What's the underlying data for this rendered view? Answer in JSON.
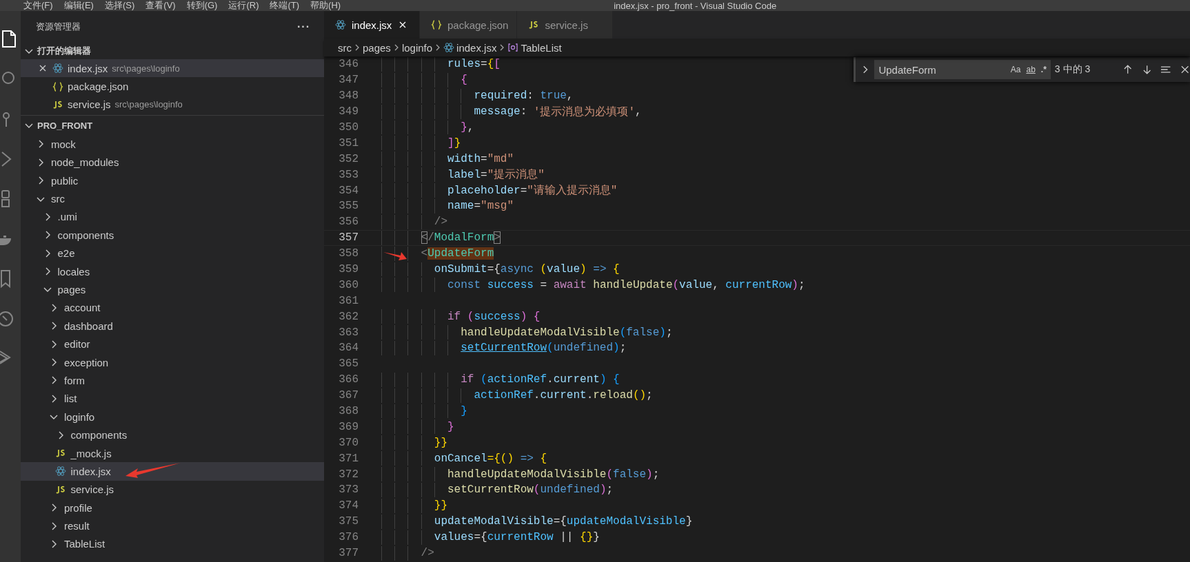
{
  "menu_bar": {
    "items": [
      "文件(F)",
      "编辑(E)",
      "选择(S)",
      "查看(V)",
      "转到(G)",
      "运行(R)",
      "终端(T)",
      "帮助(H)"
    ],
    "title": "index.jsx - pro_front - Visual Studio Code"
  },
  "explorer": {
    "title": "资源管理器",
    "more": "···",
    "open_editors": {
      "title": "打开的编辑器",
      "expanded": true,
      "items": [
        {
          "name": "index.jsx",
          "path": "src\\pages\\loginfo",
          "kind": "react",
          "selected": true
        },
        {
          "name": "package.json",
          "kind": "json",
          "selected": false
        },
        {
          "name": "service.js",
          "path": "src\\pages\\loginfo",
          "kind": "js",
          "selected": false
        }
      ]
    },
    "project": {
      "title": "PRO_FRONT",
      "expanded": true
    },
    "tree": [
      {
        "name": "mock",
        "kind": "folder",
        "expanded": false,
        "selected": false
      },
      {
        "name": "node_modules",
        "kind": "folder",
        "expanded": false,
        "selected": false
      },
      {
        "name": "public",
        "kind": "folder",
        "expanded": false,
        "selected": false
      },
      {
        "name": "src",
        "kind": "folder",
        "expanded": true,
        "selected": false,
        "children": [
          {
            "name": ".umi",
            "kind": "folder",
            "expanded": false,
            "selected": false
          },
          {
            "name": "components",
            "kind": "folder",
            "expanded": false,
            "selected": false
          },
          {
            "name": "e2e",
            "kind": "folder",
            "expanded": false,
            "selected": false
          },
          {
            "name": "locales",
            "kind": "folder",
            "expanded": false,
            "selected": false
          },
          {
            "name": "pages",
            "kind": "folder",
            "expanded": true,
            "selected": false,
            "children": [
              {
                "name": "account",
                "kind": "folder",
                "expanded": false,
                "selected": false
              },
              {
                "name": "dashboard",
                "kind": "folder",
                "expanded": false,
                "selected": false
              },
              {
                "name": "editor",
                "kind": "folder",
                "expanded": false,
                "selected": false
              },
              {
                "name": "exception",
                "kind": "folder",
                "expanded": false,
                "selected": false
              },
              {
                "name": "form",
                "kind": "folder",
                "expanded": false,
                "selected": false
              },
              {
                "name": "list",
                "kind": "folder",
                "expanded": false,
                "selected": false
              },
              {
                "name": "loginfo",
                "kind": "folder",
                "expanded": true,
                "selected": false,
                "children": [
                  {
                    "name": "components",
                    "kind": "folder",
                    "expanded": false,
                    "selected": false
                  },
                  {
                    "name": "_mock.js",
                    "kind": "js",
                    "selected": false
                  },
                  {
                    "name": "index.jsx",
                    "kind": "react",
                    "selected": true
                  },
                  {
                    "name": "service.js",
                    "kind": "js",
                    "selected": false
                  }
                ]
              },
              {
                "name": "profile",
                "kind": "folder",
                "expanded": false,
                "selected": false
              },
              {
                "name": "result",
                "kind": "folder",
                "expanded": false,
                "selected": false
              },
              {
                "name": "TableList",
                "kind": "folder",
                "expanded": false,
                "selected": false
              }
            ]
          }
        ]
      }
    ]
  },
  "tabs": [
    {
      "label": "index.jsx",
      "kind": "react",
      "selected": true
    },
    {
      "label": "package.json",
      "kind": "json",
      "selected": false
    },
    {
      "label": "service.js",
      "kind": "js",
      "selected": false
    }
  ],
  "breadcrumb": [
    "src",
    "pages",
    "loginfo",
    "index.jsx",
    "TableList"
  ],
  "find": {
    "value": "UpdateForm",
    "options": [
      "Aa",
      "ab",
      ".*"
    ],
    "count": "3 中的 3"
  },
  "code": [
    {
      "n": "346",
      "current": false,
      "tokens": [
        {
          "t": "          rules",
          "kind": "attr"
        },
        {
          "t": "=",
          "kind": "plain"
        },
        {
          "t": "{",
          "kind": "gold"
        },
        {
          "t": "[",
          "kind": "magenta"
        }
      ]
    },
    {
      "n": "347",
      "current": false,
      "tokens": [
        {
          "t": "            {",
          "kind": "magenta"
        }
      ]
    },
    {
      "n": "348",
      "current": false,
      "tokens": [
        {
          "t": "              required",
          "kind": "attr"
        },
        {
          "t": ": ",
          "kind": "plain"
        },
        {
          "t": "true",
          "kind": "keyword"
        },
        {
          "t": ",",
          "kind": "plain"
        }
      ]
    },
    {
      "n": "349",
      "current": false,
      "tokens": [
        {
          "t": "              message",
          "kind": "attr"
        },
        {
          "t": ": ",
          "kind": "plain"
        },
        {
          "t": "'提示消息为必填项'",
          "kind": "string"
        },
        {
          "t": ",",
          "kind": "plain"
        }
      ]
    },
    {
      "n": "350",
      "current": false,
      "tokens": [
        {
          "t": "            }",
          "kind": "magenta"
        },
        {
          "t": ",",
          "kind": "plain"
        }
      ]
    },
    {
      "n": "351",
      "current": false,
      "tokens": [
        {
          "t": "          ]",
          "kind": "magenta"
        },
        {
          "t": "}",
          "kind": "gold"
        }
      ]
    },
    {
      "n": "352",
      "current": false,
      "tokens": [
        {
          "t": "          width",
          "kind": "attr"
        },
        {
          "t": "=",
          "kind": "plain"
        },
        {
          "t": "\"md\"",
          "kind": "string"
        }
      ]
    },
    {
      "n": "353",
      "current": false,
      "tokens": [
        {
          "t": "          label",
          "kind": "attr"
        },
        {
          "t": "=",
          "kind": "plain"
        },
        {
          "t": "\"提示消息\"",
          "kind": "string"
        }
      ]
    },
    {
      "n": "354",
      "current": false,
      "tokens": [
        {
          "t": "          placeholder",
          "kind": "attr"
        },
        {
          "t": "=",
          "kind": "plain"
        },
        {
          "t": "\"请输入提示消息\"",
          "kind": "string"
        }
      ]
    },
    {
      "n": "355",
      "current": false,
      "tokens": [
        {
          "t": "          name",
          "kind": "attr"
        },
        {
          "t": "=",
          "kind": "plain"
        },
        {
          "t": "\"msg\"",
          "kind": "string"
        }
      ]
    },
    {
      "n": "356",
      "current": false,
      "tokens": [
        {
          "t": "        />",
          "kind": "punct"
        }
      ]
    },
    {
      "n": "357",
      "current": true,
      "tokens": [
        {
          "t": "      <",
          "kind": "matched"
        },
        {
          "t": "/",
          "kind": "punct"
        },
        {
          "t": "ModalForm",
          "kind": "tag"
        },
        {
          "t": ">",
          "kind": "matched"
        }
      ]
    },
    {
      "n": "358",
      "current": false,
      "tokens": [
        {
          "t": "      <",
          "kind": "punct"
        },
        {
          "t": "UpdateForm",
          "kind": "found"
        }
      ]
    },
    {
      "n": "359",
      "current": false,
      "tokens": [
        {
          "t": "        onSubmit",
          "kind": "attr"
        },
        {
          "t": "={",
          "kind": "plain"
        },
        {
          "t": "async ",
          "kind": "keyword"
        },
        {
          "t": "(",
          "kind": "gold"
        },
        {
          "t": "value",
          "kind": "attr"
        },
        {
          "t": ")",
          "kind": "gold"
        },
        {
          "t": " => ",
          "kind": "keyword"
        },
        {
          "t": "{",
          "kind": "gold"
        }
      ]
    },
    {
      "n": "360",
      "current": false,
      "tokens": [
        {
          "t": "          const",
          "kind": "keyword"
        },
        {
          "t": " success",
          "kind": "variable"
        },
        {
          "t": " = ",
          "kind": "plain"
        },
        {
          "t": "await",
          "kind": "control"
        },
        {
          "t": " handleUpdate",
          "kind": "function"
        },
        {
          "t": "(",
          "kind": "magenta"
        },
        {
          "t": "value",
          "kind": "attr"
        },
        {
          "t": ", ",
          "kind": "plain"
        },
        {
          "t": "currentRow",
          "kind": "variable"
        },
        {
          "t": ")",
          "kind": "magenta"
        },
        {
          "t": ";",
          "kind": "plain"
        }
      ]
    },
    {
      "n": "361",
      "current": false
    },
    {
      "n": "362",
      "current": false,
      "tokens": [
        {
          "t": "          if",
          "kind": "control"
        },
        {
          "t": " (",
          "kind": "magenta"
        },
        {
          "t": "success",
          "kind": "variable"
        },
        {
          "t": ")",
          "kind": "magenta"
        },
        {
          "t": " {",
          "kind": "magenta"
        }
      ]
    },
    {
      "n": "363",
      "current": false,
      "tokens": [
        {
          "t": "            handleUpdateModalVisible",
          "kind": "function"
        },
        {
          "t": "(",
          "kind": "blue"
        },
        {
          "t": "false",
          "kind": "keyword"
        },
        {
          "t": ")",
          "kind": "blue"
        },
        {
          "t": ";",
          "kind": "plain"
        }
      ]
    },
    {
      "n": "364",
      "current": false,
      "tokens": [
        {
          "t": "            setCurrentRow",
          "kind": "link"
        },
        {
          "t": "(",
          "kind": "blue"
        },
        {
          "t": "undefined",
          "kind": "keyword"
        },
        {
          "t": ")",
          "kind": "blue"
        },
        {
          "t": ";",
          "kind": "plain"
        }
      ]
    },
    {
      "n": "365",
      "current": false
    },
    {
      "n": "366",
      "current": false,
      "tokens": [
        {
          "t": "            if",
          "kind": "control"
        },
        {
          "t": " (",
          "kind": "blue"
        },
        {
          "t": "actionRef",
          "kind": "variable"
        },
        {
          "t": ".",
          "kind": "plain"
        },
        {
          "t": "current",
          "kind": "attr"
        },
        {
          "t": ")",
          "kind": "blue"
        },
        {
          "t": " {",
          "kind": "blue"
        }
      ]
    },
    {
      "n": "367",
      "current": false,
      "tokens": [
        {
          "t": "              actionRef",
          "kind": "variable"
        },
        {
          "t": ".",
          "kind": "plain"
        },
        {
          "t": "current",
          "kind": "attr"
        },
        {
          "t": ".",
          "kind": "plain"
        },
        {
          "t": "reload",
          "kind": "function"
        },
        {
          "t": "()",
          "kind": "gold"
        },
        {
          "t": ";",
          "kind": "plain"
        }
      ]
    },
    {
      "n": "368",
      "current": false,
      "tokens": [
        {
          "t": "            }",
          "kind": "blue"
        }
      ]
    },
    {
      "n": "369",
      "current": false,
      "tokens": [
        {
          "t": "          }",
          "kind": "magenta"
        }
      ]
    },
    {
      "n": "370",
      "current": false,
      "tokens": [
        {
          "t": "        }}",
          "kind": "gold"
        }
      ]
    },
    {
      "n": "371",
      "current": false,
      "tokens": [
        {
          "t": "        onCancel",
          "kind": "attr"
        },
        {
          "t": "={",
          "kind": "gold"
        },
        {
          "t": "()",
          "kind": "gold"
        },
        {
          "t": " => ",
          "kind": "keyword"
        },
        {
          "t": "{",
          "kind": "gold"
        }
      ]
    },
    {
      "n": "372",
      "current": false,
      "tokens": [
        {
          "t": "          handleUpdateModalVisible",
          "kind": "function"
        },
        {
          "t": "(",
          "kind": "magenta"
        },
        {
          "t": "false",
          "kind": "keyword"
        },
        {
          "t": ")",
          "kind": "magenta"
        },
        {
          "t": ";",
          "kind": "plain"
        }
      ]
    },
    {
      "n": "373",
      "current": false,
      "tokens": [
        {
          "t": "          setCurrentRow",
          "kind": "function"
        },
        {
          "t": "(",
          "kind": "magenta"
        },
        {
          "t": "undefined",
          "kind": "keyword"
        },
        {
          "t": ")",
          "kind": "magenta"
        },
        {
          "t": ";",
          "kind": "plain"
        }
      ]
    },
    {
      "n": "374",
      "current": false,
      "tokens": [
        {
          "t": "        }}",
          "kind": "gold"
        }
      ]
    },
    {
      "n": "375",
      "current": false,
      "tokens": [
        {
          "t": "        updateModalVisible",
          "kind": "attr"
        },
        {
          "t": "={",
          "kind": "plain"
        },
        {
          "t": "updateModalVisible",
          "kind": "variable"
        },
        {
          "t": "}",
          "kind": "plain"
        }
      ]
    },
    {
      "n": "376",
      "current": false,
      "tokens": [
        {
          "t": "        values",
          "kind": "attr"
        },
        {
          "t": "={",
          "kind": "plain"
        },
        {
          "t": "currentRow",
          "kind": "variable"
        },
        {
          "t": " || ",
          "kind": "plain"
        },
        {
          "t": "{}",
          "kind": "gold"
        },
        {
          "t": "}",
          "kind": "plain"
        }
      ]
    },
    {
      "n": "377",
      "current": false,
      "tokens": [
        {
          "t": "      />",
          "kind": "punct"
        }
      ]
    }
  ]
}
